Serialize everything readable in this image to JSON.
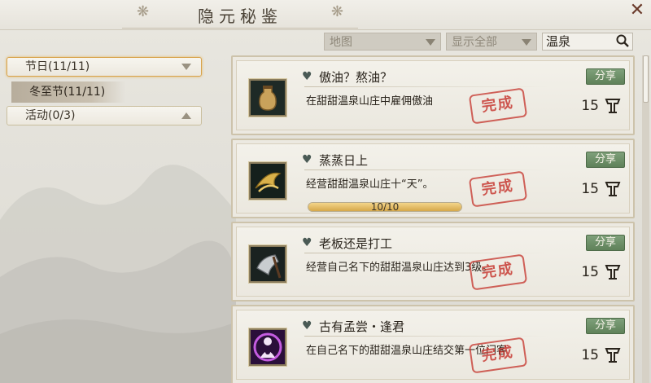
{
  "window": {
    "title": "隐元秘鉴",
    "close_icon": "close-icon"
  },
  "filters": {
    "map_placeholder": "地图",
    "show_all_label": "显示全部",
    "search_value": "温泉"
  },
  "sidebar": {
    "categories": [
      {
        "label": "节日(11/11)",
        "expanded": true,
        "selected": true
      },
      {
        "label": "活动(0/3)",
        "expanded": false,
        "selected": false
      }
    ],
    "subitems": [
      {
        "label": "冬至节(11/11)",
        "selected": true
      }
    ]
  },
  "achievements": [
    {
      "title": "傲油？熬油？",
      "description": "在甜甜温泉山庄中雇佣傲油",
      "points": "15",
      "share_label": "分享",
      "stamp": "完成",
      "icon": "oil-bottle-icon"
    },
    {
      "title": "蒸蒸日上",
      "description": "经营甜甜温泉山庄十“天”。",
      "points": "15",
      "share_label": "分享",
      "stamp": "完成",
      "icon": "golden-scroll-icon",
      "progress": {
        "text": "10/10",
        "fraction": 1.0
      }
    },
    {
      "title": "老板还是打工",
      "description": "经营自己名下的甜甜温泉山庄达到3级。",
      "points": "15",
      "share_label": "分享",
      "stamp": "完成",
      "icon": "axe-blade-icon"
    },
    {
      "title": "古有孟尝・逢君",
      "description": "在自己名下的甜甜温泉山庄结交第一位门客",
      "points": "15",
      "share_label": "分享",
      "stamp": "完成",
      "icon": "purple-figure-icon"
    }
  ],
  "colors": {
    "share_button": "#6a8c64",
    "stamp": "#c43028",
    "progress_fill": "#d5a84a"
  }
}
